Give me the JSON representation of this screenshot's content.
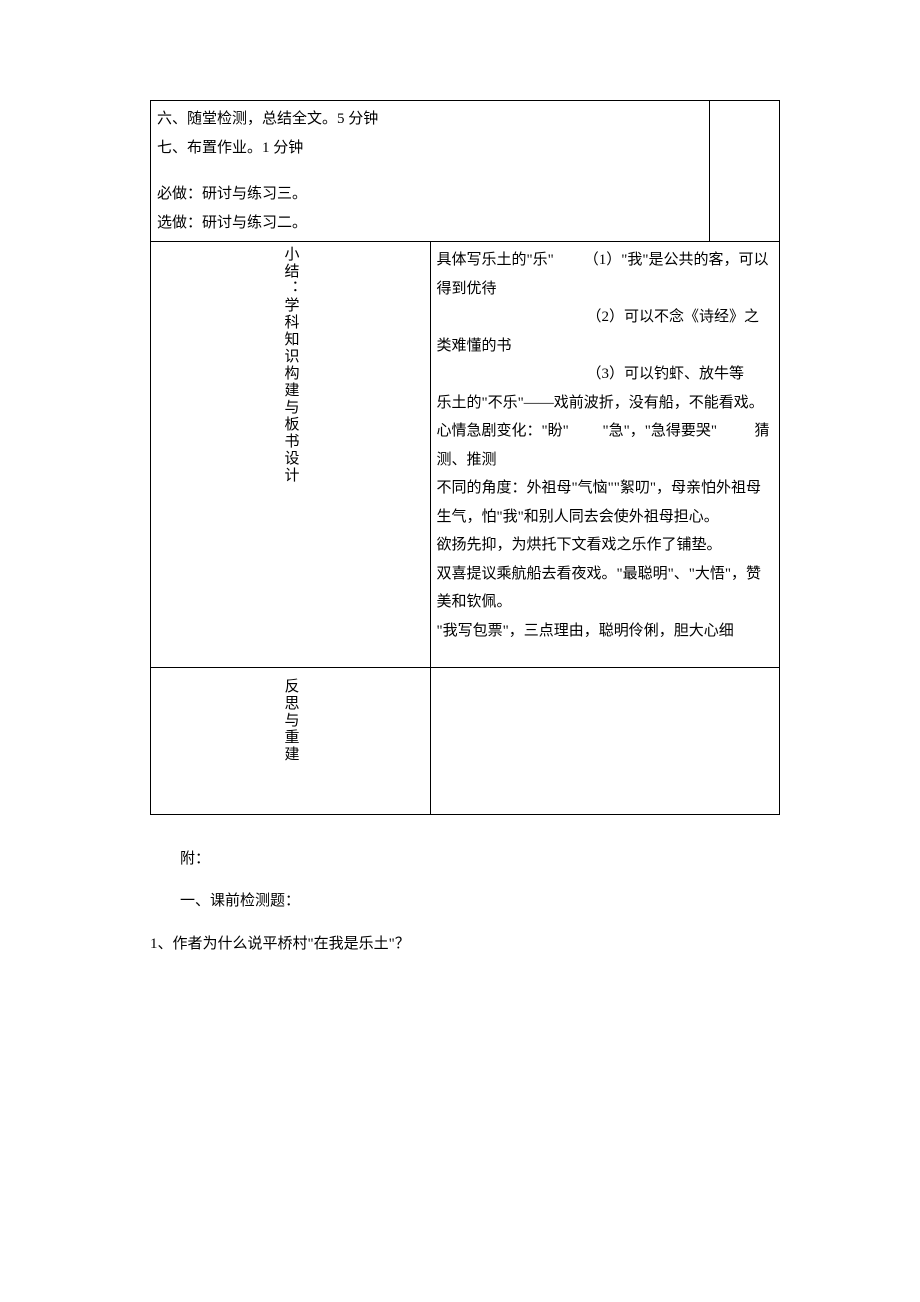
{
  "table": {
    "row1": {
      "content": {
        "line1": "六、随堂检测，总结全文。5 分钟",
        "line2": "七、布置作业。1 分钟",
        "line3": "必做：研讨与练习三。",
        "line4": "选做：研讨与练习二。"
      }
    },
    "row2": {
      "label": "小结：学科知识构建与板书设计",
      "content": {
        "line1": "具体写乐土的\"乐\"        （1）\"我\"是公共的客，可以得到优待",
        "line2": "                                        （2）可以不念《诗经》之类难懂的书",
        "line3": "                                        （3）可以钓虾、放牛等",
        "line4": "乐土的\"不乐\"——戏前波折，没有船，不能看戏。",
        "line5": "心情急剧变化：\"盼\"         \"急\"，\"急得要哭\"          猜测、推测",
        "line6": "不同的角度：外祖母\"气恼\"\"絮叨\"，母亲怕外祖母生气，怕\"我\"和别人同去会使外祖母担心。",
        "line7": "欲扬先抑，为烘托下文看戏之乐作了铺垫。",
        "line8": "双喜提议乘航船去看夜戏。\"最聪明\"、\"大悟\"，赞美和钦佩。",
        "line9": "\"我写包票\"，三点理由，聪明伶俐，胆大心细"
      }
    },
    "row3": {
      "label": "反思与重建",
      "content": ""
    }
  },
  "appendix": {
    "p1": "附：",
    "p2": "一、课前检测题：",
    "p3": "1、作者为什么说平桥村\"在我是乐土\"？"
  }
}
